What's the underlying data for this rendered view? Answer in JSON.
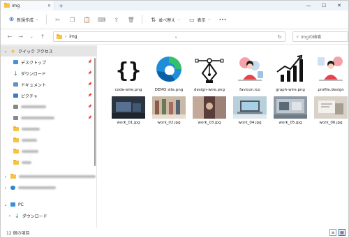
{
  "window": {
    "tab_title": "img",
    "minimize": "—",
    "maximize": "☐",
    "close": "✕"
  },
  "toolbar": {
    "new_label": "新規作成",
    "sort_label": "並べ替え",
    "view_label": "表示",
    "more_label": "•••"
  },
  "address": {
    "path": "img"
  },
  "search": {
    "placeholder": "imgの検索"
  },
  "sidebar": {
    "quick_access": "クイック アクセス",
    "items": [
      {
        "label": "デスクトップ",
        "icon": "desktop-icon"
      },
      {
        "label": "ダウンロード",
        "icon": "download-icon"
      },
      {
        "label": "ドキュメント",
        "icon": "document-icon"
      },
      {
        "label": "ピクチャ",
        "icon": "picture-icon"
      }
    ],
    "pc_label": "PC",
    "pc_download": "ダウンロード"
  },
  "files_row1": [
    {
      "name": "code-wire.png",
      "icon": "braces-icon"
    },
    {
      "name": "DEMO site.png",
      "icon": "edge-logo-icon"
    },
    {
      "name": "design-wire.png",
      "icon": "pen-tool-icon"
    },
    {
      "name": "favicon.ico",
      "icon": "woman-illustration-icon"
    },
    {
      "name": "graph-wire.png",
      "icon": "growth-chart-icon"
    },
    {
      "name": "profile.design",
      "icon": "woman-illustration-icon"
    }
  ],
  "files_row2": [
    {
      "name": "work_01.jpg",
      "icon": "photo-icon",
      "color": "#2c3440"
    },
    {
      "name": "work_02.jpg",
      "icon": "photo-icon",
      "color": "#c9b9a6"
    },
    {
      "name": "work_03.jpg",
      "icon": "photo-icon",
      "color": "#7d5a52"
    },
    {
      "name": "work_04.jpg",
      "icon": "photo-icon",
      "color": "#b9cfd9"
    },
    {
      "name": "work_05.jpg",
      "icon": "photo-icon",
      "color": "#8e9aa5"
    },
    {
      "name": "work_06.jpg",
      "icon": "photo-icon",
      "color": "#d8d2c8"
    }
  ],
  "status": {
    "count": "12 個の項目"
  }
}
